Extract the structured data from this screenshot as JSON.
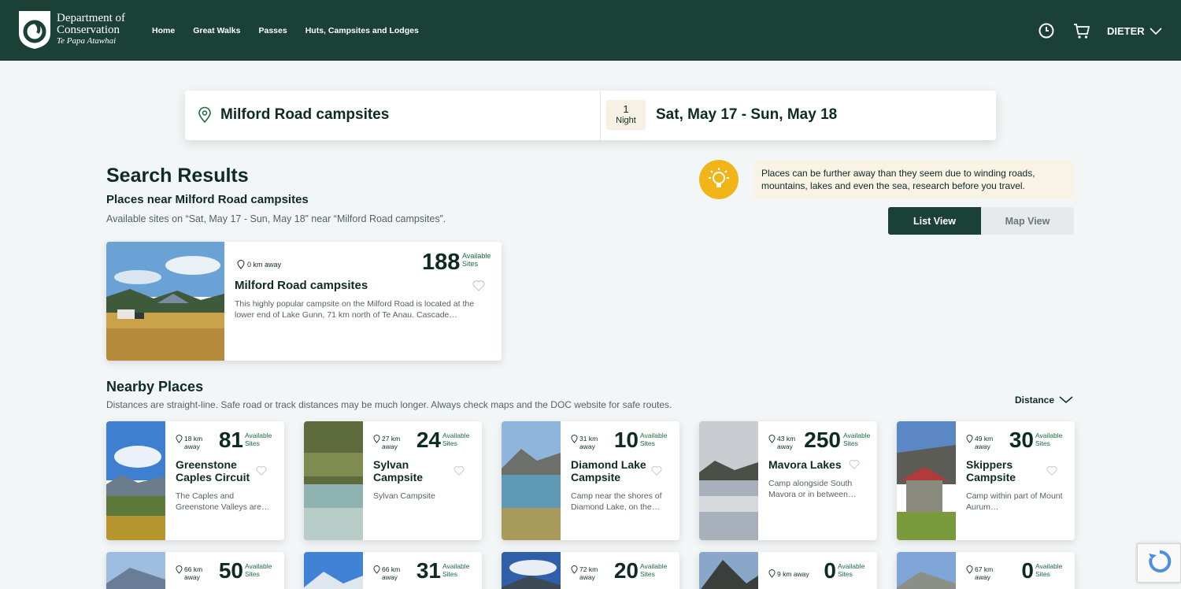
{
  "header": {
    "logo": {
      "line1": "Department of",
      "line2": "Conservation",
      "line3": "Te Papa Atawhai"
    },
    "nav": [
      "Home",
      "Great Walks",
      "Passes",
      "Huts, Campsites and Lodges"
    ],
    "user": "DIETER"
  },
  "search": {
    "place": "Milford Road campsites",
    "nights_count": "1",
    "nights_label": "Night",
    "dates": "Sat, May 17 - Sun, May 18"
  },
  "results": {
    "title": "Search Results",
    "subtitle": "Places near Milford Road campsites",
    "description": "Available sites on “Sat, May 17 - Sun, May 18” near “Milford Road campsites”.",
    "tip": "Places can be further away than they seem due to winding roads, mountains, lakes and even the sea, research before you travel.",
    "view_list": "List View",
    "view_map": "Map View"
  },
  "main_result": {
    "distance": "0 km away",
    "count": "188",
    "available_label": "Available Sites",
    "name": "Milford Road campsites",
    "description": "This highly popular campsite on the Milford Road is located at the lower end of Lake Gunn, 71 km north of Te Anau. Cascade…"
  },
  "nearby": {
    "title": "Nearby Places",
    "description": "Distances are straight-line. Safe road or track distances may be much longer. Always check maps and the DOC website for safe routes.",
    "sort_label": "Distance",
    "available_label": "Available Sites",
    "cards": [
      {
        "distance": "18 km away",
        "count": "81",
        "name": "Greenstone Caples Circuit",
        "description": "The Caples and Greenstone Valleys are…"
      },
      {
        "distance": "27 km away",
        "count": "24",
        "name": "Sylvan Campsite",
        "description": "Sylvan Campsite"
      },
      {
        "distance": "31 km away",
        "count": "10",
        "name": "Diamond Lake Campsite",
        "description": "Camp near the shores of Diamond Lake, on the…"
      },
      {
        "distance": "43 km away",
        "count": "250",
        "name": "Mavora Lakes",
        "description": "Camp alongside South Mavora or in between…"
      },
      {
        "distance": "49 km away",
        "count": "30",
        "name": "Skippers Campsite",
        "description": "Camp within part of Mount Aurum…"
      }
    ],
    "row2": [
      {
        "distance": "66 km away",
        "count": "50"
      },
      {
        "distance": "66 km away",
        "count": "31"
      },
      {
        "distance": "72 km away",
        "count": "20"
      },
      {
        "distance": "9 km away",
        "count": "0"
      },
      {
        "distance": "67 km away",
        "count": "0"
      }
    ]
  },
  "colors": {
    "brand": "#1b4136",
    "accent": "#f2b519",
    "tip_bg": "#f8f3e5"
  }
}
